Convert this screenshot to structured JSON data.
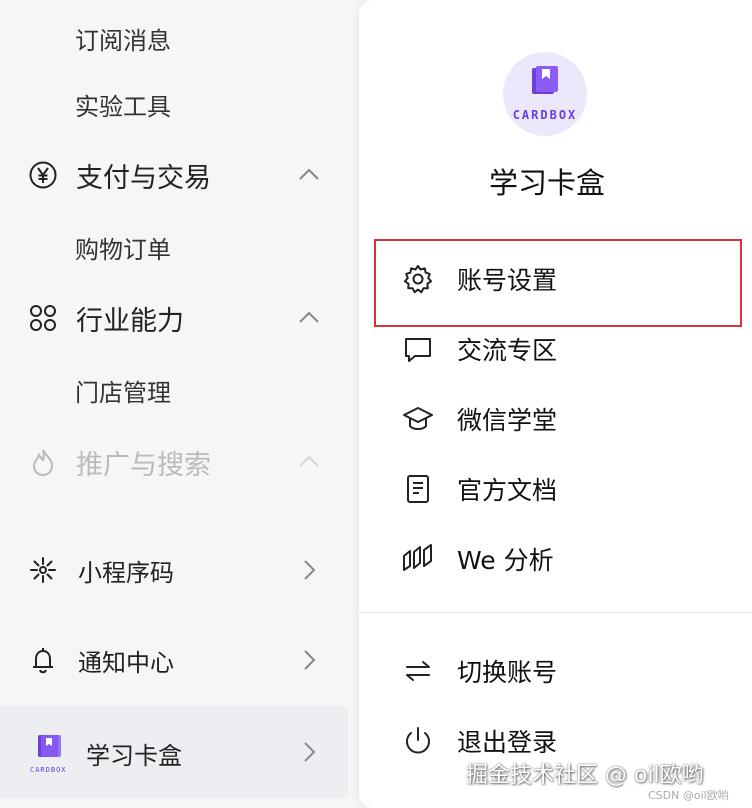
{
  "sidebar": {
    "items": [
      {
        "label": "订阅消息"
      },
      {
        "label": "实验工具"
      },
      {
        "label": "支付与交易",
        "icon": "yen-circle-icon"
      },
      {
        "label": "购物订单"
      },
      {
        "label": "行业能力",
        "icon": "nodes-icon"
      },
      {
        "label": "门店管理"
      },
      {
        "label": "推广与搜索",
        "icon": "flame-icon"
      },
      {
        "label": "小程序码",
        "icon": "qrcode-burst-icon"
      },
      {
        "label": "通知中心",
        "icon": "bell-icon"
      },
      {
        "label": "学习卡盒",
        "icon": "cardbox-logo"
      }
    ],
    "logo_small_text": "CARDBOX"
  },
  "panel": {
    "logo_text": "CARDBOX",
    "app_name": "学习卡盒",
    "menu": [
      {
        "label": "账号设置",
        "icon": "gear-icon"
      },
      {
        "label": "交流专区",
        "icon": "chat-icon"
      },
      {
        "label": "微信学堂",
        "icon": "graduation-cap-icon"
      },
      {
        "label": "官方文档",
        "icon": "document-icon"
      },
      {
        "label": "We 分析",
        "icon": "analytics-icon"
      },
      {
        "label": "切换账号",
        "icon": "switch-arrows-icon"
      },
      {
        "label": "退出登录",
        "icon": "power-icon"
      }
    ]
  },
  "watermark": {
    "text": "掘金技术社区 @ oil欧哟",
    "csdn": "CSDN @oil欧哟"
  },
  "colors": {
    "highlight_border": "#d8323a",
    "logo_bg": "#ece8fb",
    "logo_purple": "#6b3fd8"
  }
}
